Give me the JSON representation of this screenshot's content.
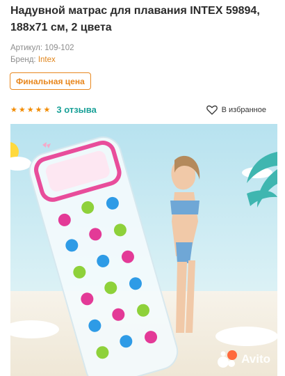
{
  "product": {
    "title": "Надувной матрас для плавания INTEX 59894, 188x71 см, 2 цвета",
    "sku_label": "Артикул:",
    "sku_value": "109-102",
    "brand_label": "Бренд:",
    "brand_value": "Intex"
  },
  "price_badge": "Финальная цена",
  "rating": {
    "stars": 5,
    "reviews_label": "3 отзыва"
  },
  "favorites_label": "В избранное",
  "watermark": "Avito",
  "colors": {
    "accent_orange": "#e8871e",
    "rating_star": "#f28b00",
    "reviews_teal": "#1aa198"
  },
  "icons": [
    "star-icon",
    "heart-icon",
    "avito-logo-icon"
  ]
}
